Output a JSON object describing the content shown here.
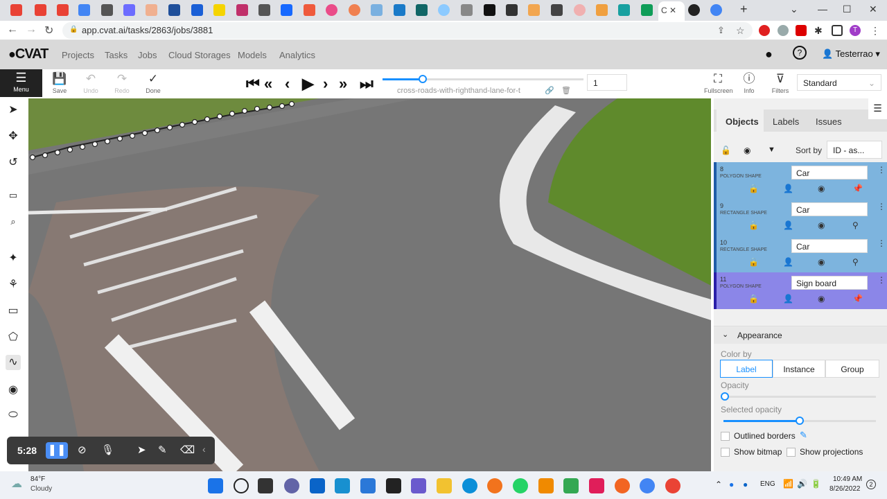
{
  "browser": {
    "active_tab_title": "C",
    "url": "app.cvat.ai/tasks/2863/jobs/3881",
    "tab_icons": [
      "gmail-icon",
      "gmail-icon",
      "gmail-icon",
      "docs-icon",
      "page-icon",
      "globe-icon",
      "misc-icon",
      "facebook-icon",
      "fiverr-icon",
      "ukraine-flag-icon",
      "s-icon",
      "tools-icon",
      "behance-icon",
      "app-icon",
      "dribbble-icon",
      "figma-icon",
      "cloud-icon",
      "app-icon",
      "app-icon",
      "cloud-icon",
      "app-icon",
      "app-icon",
      "star-icon",
      "app-icon",
      "app-icon",
      "app-icon",
      "app-icon",
      "app-icon",
      "sheets-icon"
    ]
  },
  "cvat_header": {
    "logo": "CVAT",
    "nav": [
      "Projects",
      "Tasks",
      "Jobs",
      "Cloud Storages",
      "Models",
      "Analytics"
    ],
    "user": "Testerrao"
  },
  "toolbar": {
    "menu_label": "Menu",
    "save_label": "Save",
    "undo_label": "Undo",
    "redo_label": "Redo",
    "done_label": "Done",
    "job_name": "cross-roads-with-righthand-lane-for-t",
    "frame_number": "1",
    "frame_progress": 0.2,
    "fullscreen_label": "Fullscreen",
    "info_label": "Info",
    "filters_label": "Filters",
    "workspace": "Standard"
  },
  "sidebar": {
    "tabs": [
      "Objects",
      "Labels",
      "Issues"
    ],
    "sort_by_label": "Sort by",
    "sort_value": "ID - as...",
    "objects": [
      {
        "id": "8",
        "type": "POLYGON SHAPE",
        "label": "Car",
        "color": "#7db4de"
      },
      {
        "id": "9",
        "type": "RECTANGLE SHAPE",
        "label": "Car",
        "color": "#7db4de"
      },
      {
        "id": "10",
        "type": "RECTANGLE SHAPE",
        "label": "Car",
        "color": "#7db4de"
      },
      {
        "id": "11",
        "type": "POLYGON SHAPE",
        "label": "Sign board",
        "color": "#8b86e8"
      }
    ],
    "appearance": {
      "title": "Appearance",
      "color_by_label": "Color by",
      "color_by_options": [
        "Label",
        "Instance",
        "Group"
      ],
      "color_by_selected": "Label",
      "opacity_label": "Opacity",
      "opacity_value": 0.0,
      "selected_opacity_label": "Selected opacity",
      "selected_opacity_value": 0.5,
      "outlined_borders_label": "Outlined borders",
      "show_bitmap_label": "Show bitmap",
      "show_projections_label": "Show projections"
    }
  },
  "recording": {
    "time": "5:28"
  },
  "taskbar": {
    "weather_temp": "84°F",
    "weather_desc": "Cloudy",
    "lang": "ENG",
    "time": "10:49 AM",
    "date": "8/26/2022",
    "notification_count": "2"
  }
}
